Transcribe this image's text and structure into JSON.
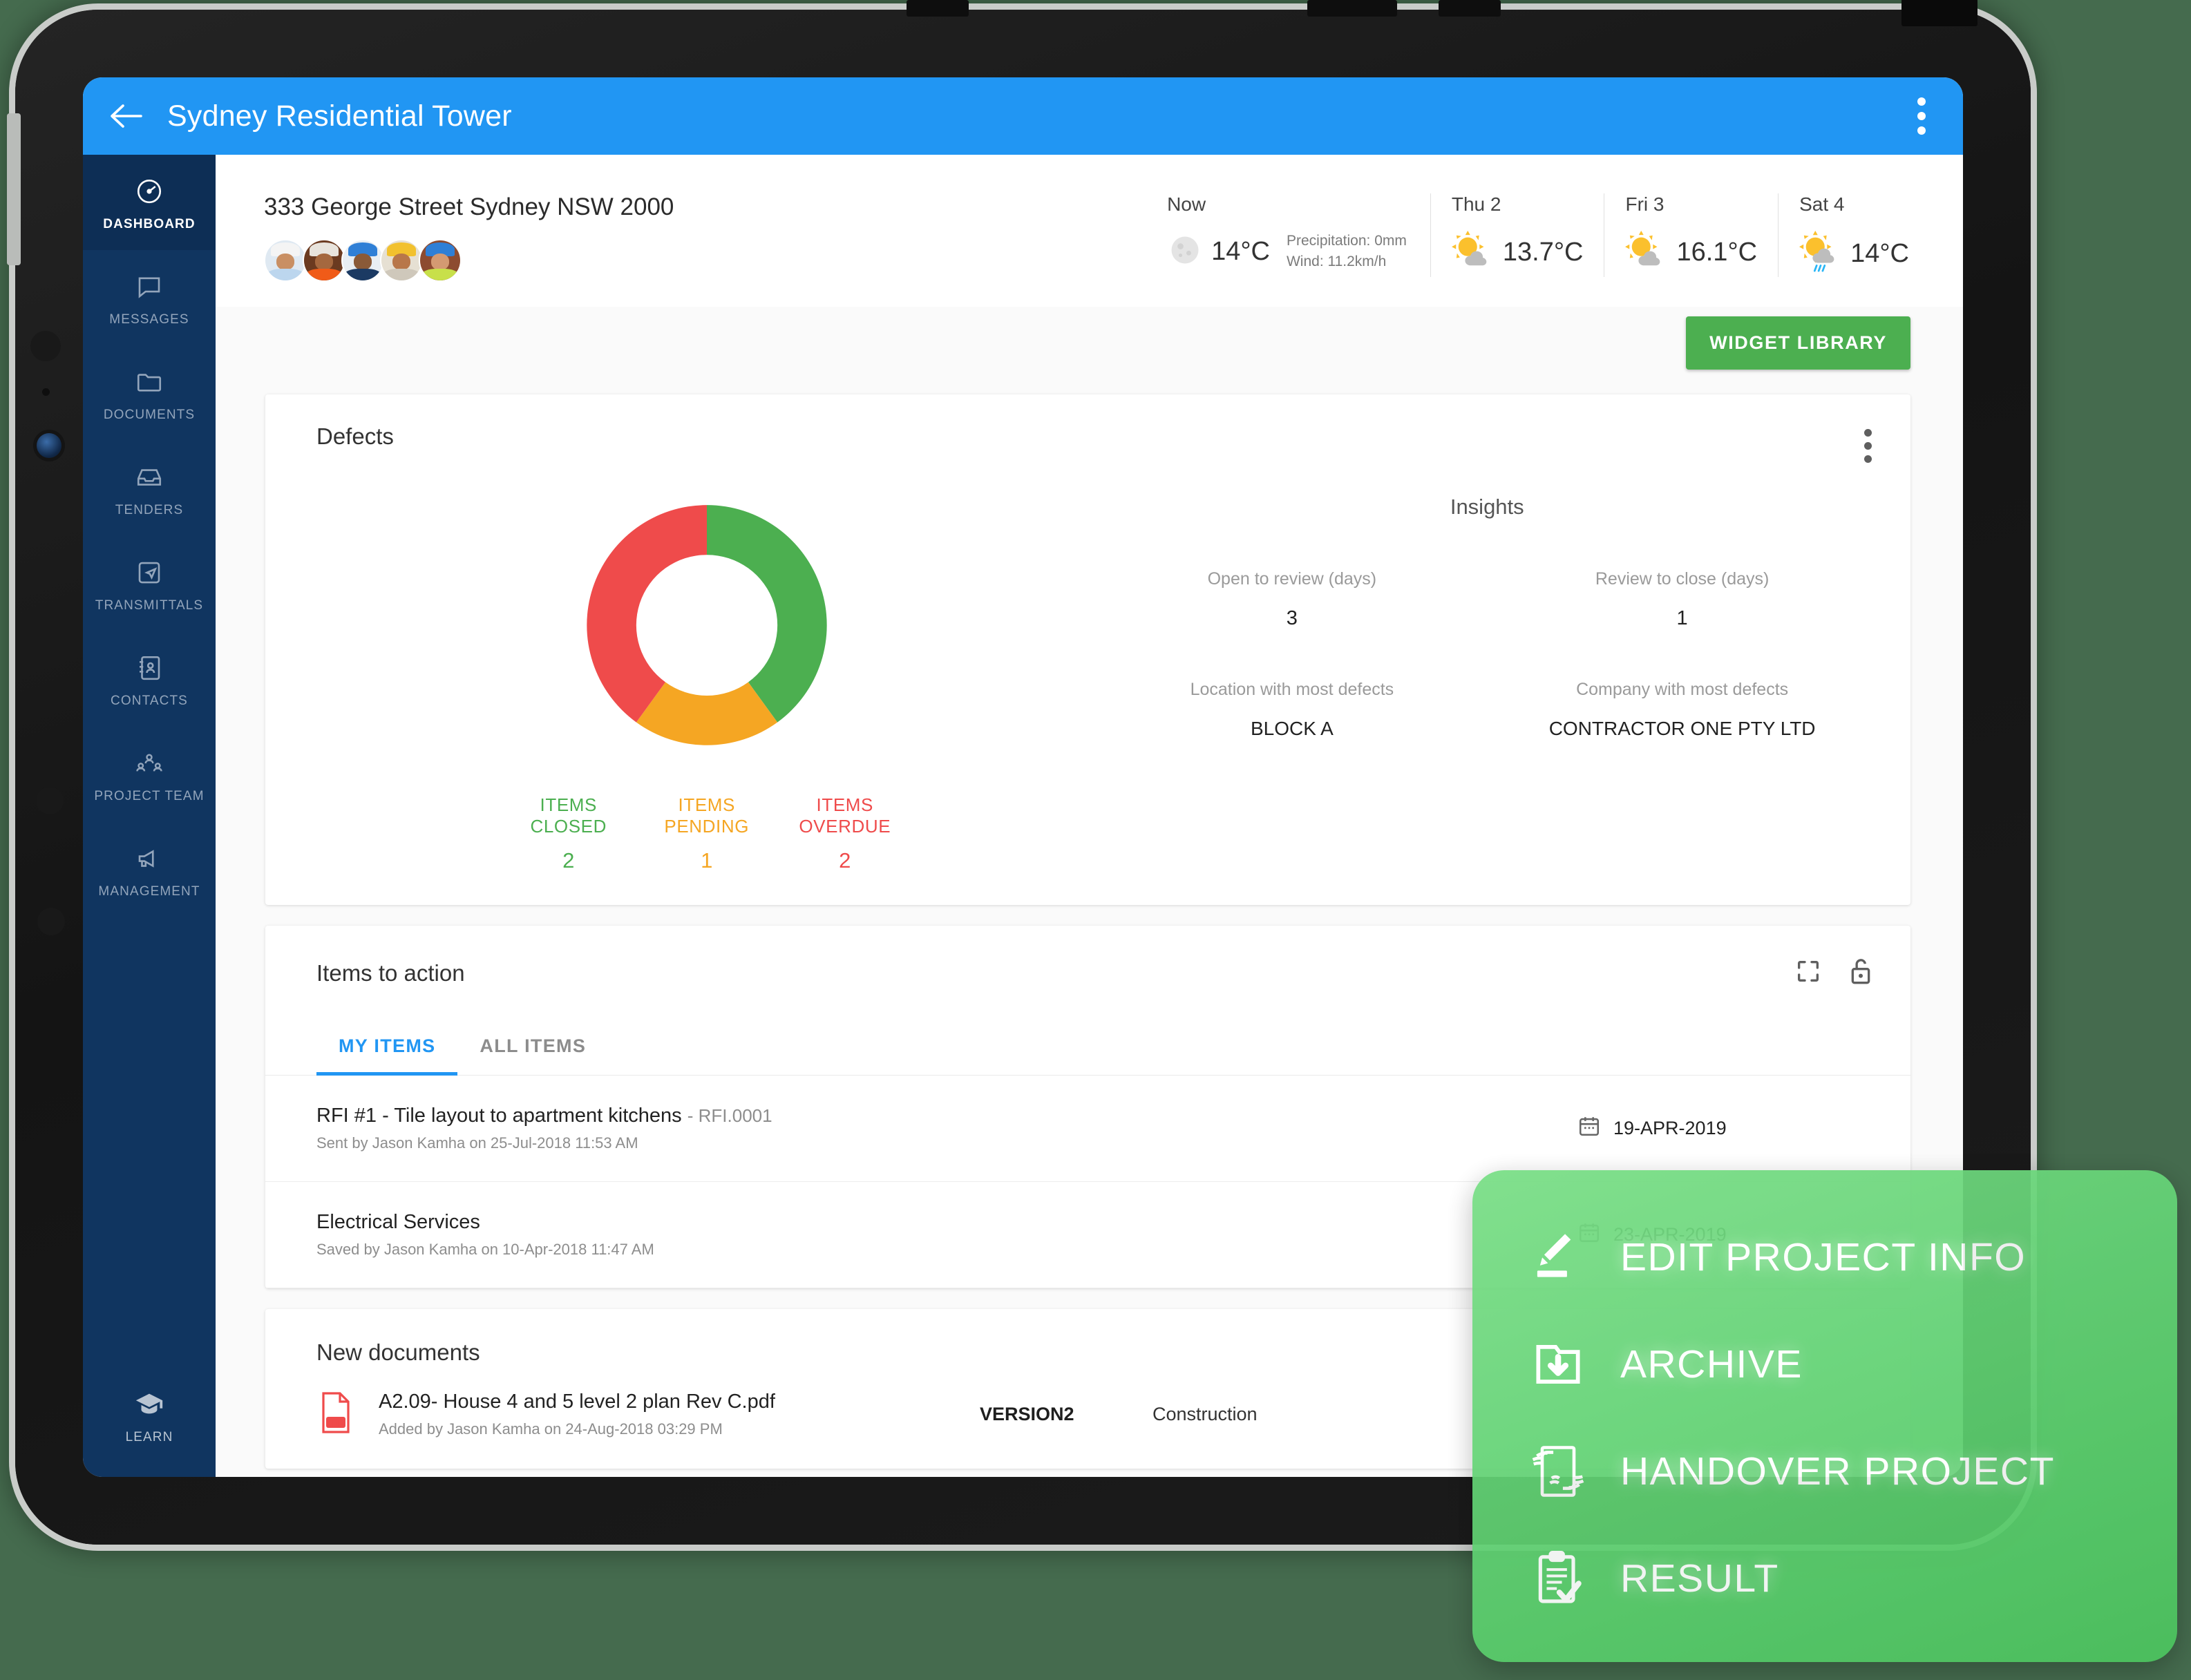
{
  "app": {
    "title": "Sydney Residential Tower",
    "back_icon": "back-arrow-icon",
    "overflow_icon": "more-vertical-icon"
  },
  "sidebar": {
    "items": [
      {
        "label": "DASHBOARD",
        "icon": "speedometer-icon",
        "active": true
      },
      {
        "label": "MESSAGES",
        "icon": "chat-bubble-icon",
        "active": false
      },
      {
        "label": "DOCUMENTS",
        "icon": "folder-icon",
        "active": false
      },
      {
        "label": "TENDERS",
        "icon": "inbox-tray-icon",
        "active": false
      },
      {
        "label": "TRANSMITTALS",
        "icon": "send-document-icon",
        "active": false
      },
      {
        "label": "CONTACTS",
        "icon": "address-book-icon",
        "active": false
      },
      {
        "label": "PROJECT TEAM",
        "icon": "people-group-icon",
        "active": false
      },
      {
        "label": "MANAGEMENT",
        "icon": "megaphone-icon",
        "active": false
      }
    ],
    "footer": {
      "label": "LEARN",
      "icon": "graduation-cap-icon"
    }
  },
  "header": {
    "address": "333 George Street Sydney NSW 2000",
    "avatar_count": 5
  },
  "weather": {
    "now": {
      "day": "Now",
      "icon": "moon-icon",
      "temp": "14°C",
      "precipitation": "Precipitation: 0mm",
      "wind": "Wind: 11.2km/h"
    },
    "forecast": [
      {
        "day": "Thu 2",
        "icon": "sun-cloud-icon",
        "temp": "13.7°C"
      },
      {
        "day": "Fri 3",
        "icon": "sun-cloud-icon",
        "temp": "16.1°C"
      },
      {
        "day": "Sat 4",
        "icon": "sun-cloud-rain-icon",
        "temp": "14°C"
      }
    ]
  },
  "widget_library_button": "WIDGET LIBRARY",
  "defects": {
    "title": "Defects",
    "insights_title": "Insights",
    "legend": [
      {
        "label": "ITEMS CLOSED",
        "value": "2",
        "color": "#4caf50"
      },
      {
        "label": "ITEMS PENDING",
        "value": "1",
        "color": "#f5a623"
      },
      {
        "label": "ITEMS OVERDUE",
        "value": "2",
        "color": "#ef4b4b"
      }
    ],
    "insights": [
      {
        "label": "Open to review (days)",
        "value": "3"
      },
      {
        "label": "Review to close (days)",
        "value": "1"
      },
      {
        "label": "Location with most defects",
        "value": "BLOCK A"
      },
      {
        "label": "Company with most defects",
        "value": "CONTRACTOR ONE PTY LTD"
      }
    ]
  },
  "chart_data": {
    "type": "pie",
    "title": "Defects",
    "categories": [
      "ITEMS CLOSED",
      "ITEMS PENDING",
      "ITEMS OVERDUE"
    ],
    "values": [
      2,
      1,
      2
    ],
    "colors": [
      "#4caf50",
      "#f5a623",
      "#ef4b4b"
    ],
    "donut": true,
    "inner_radius_ratio": 0.54,
    "start_angle_deg": 0,
    "total": 5,
    "percentages": [
      40,
      20,
      40
    ],
    "legend_position": "bottom",
    "grid": false,
    "xlabel": "",
    "ylabel": ""
  },
  "items_to_action": {
    "title": "Items to action",
    "expand_icon": "fullscreen-icon",
    "lock_icon": "unlock-icon",
    "tabs": [
      {
        "label": "MY ITEMS",
        "active": true
      },
      {
        "label": "ALL ITEMS",
        "active": false
      }
    ],
    "rows": [
      {
        "title": "RFI #1 - Tile layout to apartment kitchens",
        "code": "- RFI.0001",
        "sub": "Sent by Jason Kamha on 25-Jul-2018 11:53 AM",
        "date": "19-APR-2019",
        "date_icon": "calendar-icon"
      },
      {
        "title": "Electrical Services",
        "code": "",
        "sub": "Saved by Jason Kamha on 10-Apr-2018 11:47 AM",
        "date": "23-APR-2019",
        "date_icon": "calendar-icon"
      }
    ]
  },
  "new_documents": {
    "title": "New documents",
    "rows": [
      {
        "icon": "pdf-file-icon",
        "title": "A2.09- House 4 and 5 level 2 plan Rev C.pdf",
        "sub": "Added by Jason Kamha on 24-Aug-2018 03:29 PM",
        "version": "VERSION2",
        "status": "Construction"
      }
    ]
  },
  "action_menu": {
    "items": [
      {
        "label": "EDIT PROJECT INFO",
        "icon": "pencil-icon"
      },
      {
        "label": "ARCHIVE",
        "icon": "archive-download-icon"
      },
      {
        "label": "HANDOVER PROJECT",
        "icon": "handover-hands-icon"
      },
      {
        "label": "RESULT",
        "icon": "clipboard-check-icon"
      }
    ]
  },
  "colors": {
    "accent_blue": "#2196f3",
    "sidebar_navy": "#103560",
    "green": "#4caf50",
    "orange": "#f5a623",
    "red": "#ef4b4b",
    "page_background": "#456b4e"
  }
}
